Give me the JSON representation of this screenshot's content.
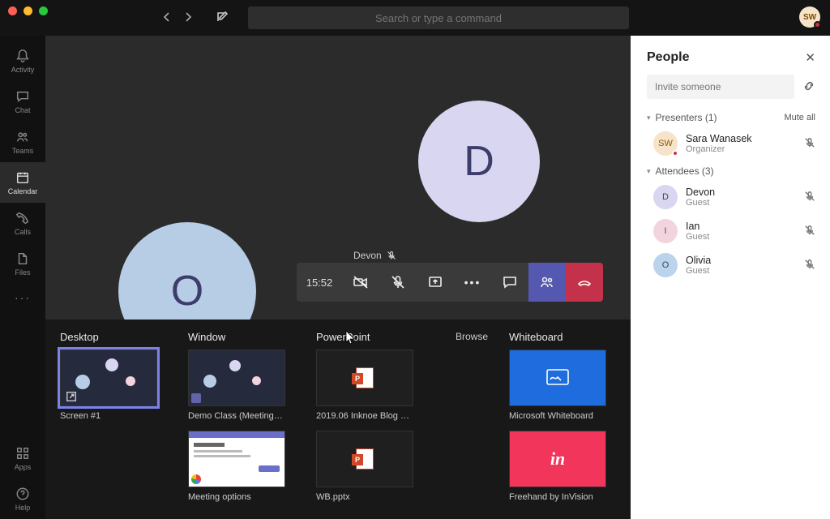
{
  "top": {
    "search_placeholder": "Search or type a command",
    "avatar_initials": "SW"
  },
  "rail": {
    "items": [
      {
        "label": "Activity"
      },
      {
        "label": "Chat"
      },
      {
        "label": "Teams"
      },
      {
        "label": "Calendar"
      },
      {
        "label": "Calls"
      },
      {
        "label": "Files"
      }
    ],
    "more": "···",
    "apps": "Apps",
    "help": "Help"
  },
  "stage": {
    "speaker_name": "Devon",
    "bubble_D": "D",
    "bubble_O": "O"
  },
  "controls": {
    "time": "15:52"
  },
  "tray": {
    "desktop_label": "Desktop",
    "desktop_item": "Screen #1",
    "window_label": "Window",
    "window_item1": "Demo Class (Meeting) | …",
    "window_item2": "Meeting options",
    "powerpoint_label": "PowerPoint",
    "browse": "Browse",
    "ppt1": "2019.06 Inknoe Blog Lau…",
    "ppt2": "WB.pptx",
    "whiteboard_label": "Whiteboard",
    "wb1": "Microsoft Whiteboard",
    "wb2": "Freehand by InVision"
  },
  "people": {
    "title": "People",
    "invite_placeholder": "Invite someone",
    "presenters_label": "Presenters (1)",
    "mute_all": "Mute all",
    "attendees_label": "Attendees (3)",
    "list": [
      {
        "initials": "SW",
        "name": "Sara Wanasek",
        "role": "Organizer",
        "cls": "sw",
        "presence": true
      },
      {
        "initials": "D",
        "name": "Devon",
        "role": "Guest",
        "cls": "d"
      },
      {
        "initials": "I",
        "name": "Ian",
        "role": "Guest",
        "cls": "i"
      },
      {
        "initials": "O",
        "name": "Olivia",
        "role": "Guest",
        "cls": "o"
      }
    ]
  }
}
